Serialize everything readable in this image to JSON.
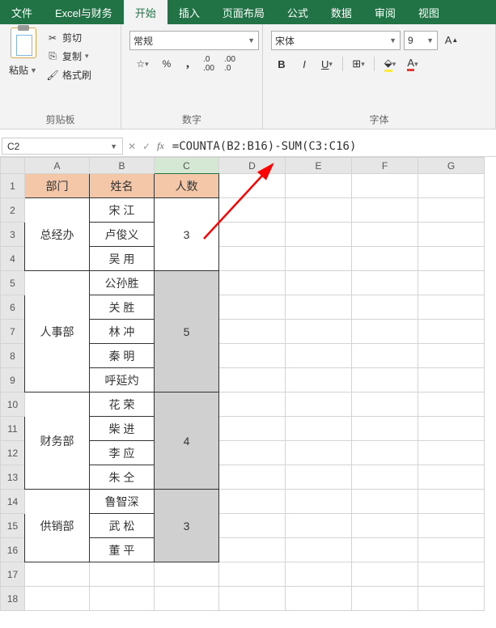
{
  "tabs": [
    "文件",
    "Excel与财务",
    "开始",
    "插入",
    "页面布局",
    "公式",
    "数据",
    "审阅",
    "视图"
  ],
  "active_tab": 2,
  "ribbon": {
    "clipboard": {
      "label": "剪贴板",
      "paste": "粘贴",
      "cut": "剪切",
      "copy": "复制",
      "format_painter": "格式刷"
    },
    "number": {
      "label": "数字",
      "format": "常规"
    },
    "font": {
      "label": "字体",
      "name": "宋体",
      "size": "9",
      "bold": "B",
      "italic": "I",
      "underline": "U"
    }
  },
  "namebox": "C2",
  "formula": "=COUNTA(B2:B16)-SUM(C3:C16)",
  "columns": [
    "A",
    "B",
    "C",
    "D",
    "E",
    "F",
    "G"
  ],
  "headers": {
    "a": "部门",
    "b": "姓名",
    "c": "人数"
  },
  "table": {
    "groups": [
      {
        "dept": "总经办",
        "count": "3",
        "names": [
          "宋  江",
          "卢俊义",
          "吴  用"
        ]
      },
      {
        "dept": "人事部",
        "count": "5",
        "names": [
          "公孙胜",
          "关  胜",
          "林  冲",
          "秦  明",
          "呼延灼"
        ]
      },
      {
        "dept": "财务部",
        "count": "4",
        "names": [
          "花  荣",
          "柴  进",
          "李  应",
          "朱  仝"
        ]
      },
      {
        "dept": "供销部",
        "count": "3",
        "names": [
          "鲁智深",
          "武  松",
          "董  平"
        ]
      }
    ]
  }
}
